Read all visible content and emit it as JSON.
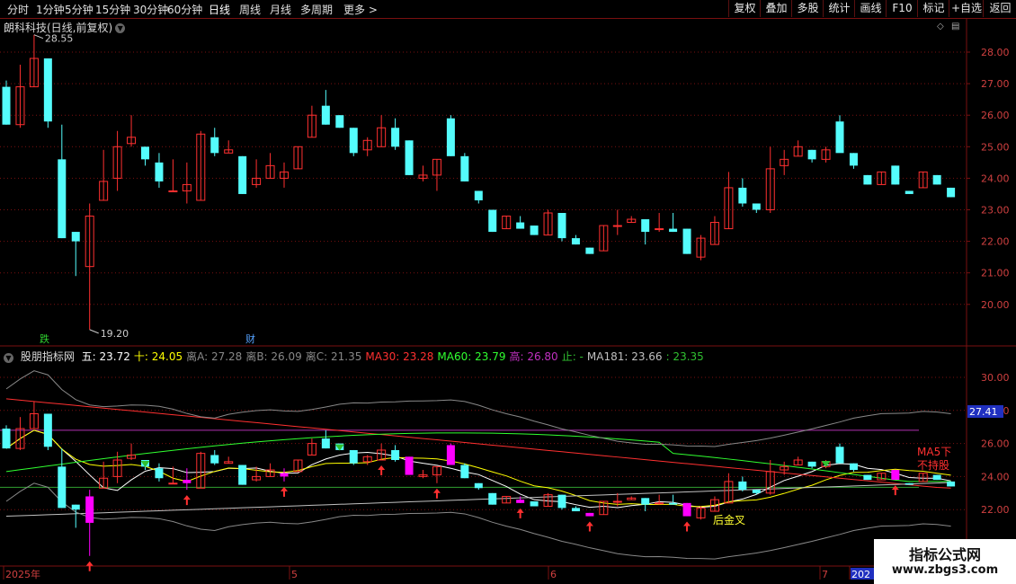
{
  "toolbar": {
    "tabs": [
      "分时",
      "1分钟",
      "5分钟",
      "15分钟",
      "30分钟",
      "60分钟",
      "日线",
      "周线",
      "月线",
      "多周期",
      "更多 >"
    ],
    "active_tab": "日线",
    "right_buttons": [
      "复权",
      "叠加",
      "多股",
      "统计",
      "画线",
      "F10",
      "标记",
      "+自选",
      "返回"
    ]
  },
  "stock_title": "朗科科技(日线,前复权)",
  "price_axis": [
    "28.00",
    "27.00",
    "26.00",
    "25.00",
    "24.00",
    "23.00",
    "22.00",
    "21.00",
    "20.00"
  ],
  "annotations": {
    "high": "28.55",
    "low": "19.20",
    "marker_die": "跌",
    "marker_cai": "财"
  },
  "indicator": {
    "name": "股朋指标网",
    "items": [
      {
        "label": "五: 23.72",
        "color": "#ffffff"
      },
      {
        "label": "十: 24.05",
        "color": "#ffff00"
      },
      {
        "label": "离A: 27.28",
        "color": "#888888"
      },
      {
        "label": "离B: 26.09",
        "color": "#888888"
      },
      {
        "label": "离C: 21.35",
        "color": "#888888"
      },
      {
        "label": "MA30: 23.28",
        "color": "#ff3030"
      },
      {
        "label": "MA60: 23.79",
        "color": "#30ff30"
      },
      {
        "label": "高: 26.80",
        "color": "#c030c0"
      },
      {
        "label": "止: -",
        "color": "#30c030"
      },
      {
        "label": "MA181: 23.66",
        "color": "#c0c0c0"
      },
      {
        "label": ": 23.35",
        "color": "#30c030"
      }
    ],
    "axis": [
      "30.00",
      "28.00",
      "26.00",
      "24.00",
      "22.00"
    ],
    "current_value": "27.41",
    "note_ma5": "MA5下\n不持股",
    "note_cross": "后金叉"
  },
  "date_axis": [
    "2025年",
    "5",
    "6",
    "7",
    "202"
  ],
  "watermark": {
    "line1": "指标公式网",
    "line2": "www.zbgs3.com"
  },
  "colors": {
    "up": "#ff3030",
    "down": "#54fcfc",
    "grid": "#7a1010",
    "magenta": "#ff00ff",
    "green_arrow": "#30c030"
  },
  "chart_data": {
    "type": "candlestick",
    "candles": [
      [
        26.9,
        27.1,
        25.7,
        25.7
      ],
      [
        25.7,
        27.6,
        25.6,
        26.9
      ],
      [
        26.9,
        28.55,
        26.9,
        27.8
      ],
      [
        27.8,
        27.8,
        25.6,
        25.8
      ],
      [
        24.6,
        25.7,
        22.1,
        22.1
      ],
      [
        22.3,
        22.3,
        20.9,
        22.0
      ],
      [
        21.2,
        23.2,
        19.2,
        22.8
      ],
      [
        23.3,
        24.9,
        23.3,
        23.9
      ],
      [
        24.0,
        25.5,
        23.6,
        25.0
      ],
      [
        25.1,
        26.0,
        25.0,
        25.3
      ],
      [
        25.0,
        25.0,
        24.4,
        24.6
      ],
      [
        24.5,
        24.8,
        23.7,
        23.9
      ],
      [
        23.6,
        24.6,
        23.6,
        23.6
      ],
      [
        23.6,
        24.5,
        23.2,
        23.8
      ],
      [
        23.3,
        25.5,
        23.3,
        25.4
      ],
      [
        25.3,
        25.6,
        24.7,
        24.8
      ],
      [
        24.8,
        25.2,
        24.8,
        24.9
      ],
      [
        24.7,
        24.7,
        23.5,
        23.5
      ],
      [
        23.8,
        24.6,
        23.7,
        24.0
      ],
      [
        24.0,
        24.8,
        24.0,
        24.4
      ],
      [
        24.0,
        24.5,
        23.7,
        24.2
      ],
      [
        24.3,
        25.0,
        24.3,
        25.0
      ],
      [
        25.3,
        26.3,
        25.3,
        26.0
      ],
      [
        26.3,
        26.8,
        25.7,
        25.7
      ],
      [
        26.0,
        26.0,
        25.6,
        25.6
      ],
      [
        25.6,
        25.6,
        24.7,
        24.8
      ],
      [
        24.9,
        25.3,
        24.7,
        25.2
      ],
      [
        25.0,
        26.0,
        25.0,
        25.6
      ],
      [
        25.6,
        25.9,
        24.9,
        25.0
      ],
      [
        25.2,
        25.2,
        24.1,
        24.1
      ],
      [
        24.0,
        24.4,
        23.9,
        24.1
      ],
      [
        24.1,
        24.6,
        23.6,
        24.6
      ],
      [
        25.9,
        26.0,
        24.7,
        24.7
      ],
      [
        24.7,
        24.8,
        23.9,
        23.9
      ],
      [
        23.6,
        23.6,
        23.2,
        23.3
      ],
      [
        23.0,
        23.0,
        22.3,
        22.3
      ],
      [
        22.4,
        22.8,
        22.4,
        22.8
      ],
      [
        22.6,
        22.8,
        22.4,
        22.4
      ],
      [
        22.5,
        22.5,
        22.2,
        22.2
      ],
      [
        22.2,
        23.0,
        22.2,
        22.9
      ],
      [
        22.9,
        22.9,
        22.0,
        22.1
      ],
      [
        22.1,
        22.2,
        21.9,
        21.9
      ],
      [
        21.8,
        21.8,
        21.6,
        21.6
      ],
      [
        21.7,
        22.5,
        21.7,
        22.5
      ],
      [
        22.5,
        23.0,
        22.2,
        22.5
      ],
      [
        22.6,
        22.8,
        22.6,
        22.7
      ],
      [
        22.7,
        22.7,
        21.9,
        22.3
      ],
      [
        22.4,
        22.9,
        22.3,
        22.4
      ],
      [
        22.4,
        22.9,
        22.3,
        22.3
      ],
      [
        22.4,
        22.4,
        21.6,
        21.6
      ],
      [
        21.5,
        22.2,
        21.4,
        22.1
      ],
      [
        21.9,
        22.8,
        21.9,
        22.6
      ],
      [
        22.4,
        24.2,
        22.4,
        23.7
      ],
      [
        23.7,
        24.0,
        23.1,
        23.2
      ],
      [
        23.2,
        23.2,
        22.9,
        23.0
      ],
      [
        23.0,
        25.0,
        22.9,
        24.3
      ],
      [
        24.4,
        24.9,
        24.1,
        24.6
      ],
      [
        24.7,
        25.2,
        24.7,
        25.0
      ],
      [
        24.9,
        24.9,
        24.5,
        24.6
      ],
      [
        24.6,
        25.0,
        24.5,
        24.9
      ],
      [
        25.8,
        26.0,
        24.9,
        24.8
      ],
      [
        24.8,
        24.8,
        24.3,
        24.4
      ],
      [
        24.1,
        24.1,
        23.8,
        23.8
      ],
      [
        23.8,
        24.2,
        23.8,
        24.2
      ],
      [
        24.4,
        24.4,
        23.8,
        23.8
      ],
      [
        23.6,
        23.6,
        23.5,
        23.5
      ],
      [
        23.7,
        24.2,
        23.7,
        24.2
      ],
      [
        24.1,
        24.1,
        23.8,
        23.8
      ],
      [
        23.7,
        23.7,
        23.4,
        23.4
      ]
    ],
    "ylim": [
      19.2,
      28.55
    ]
  }
}
